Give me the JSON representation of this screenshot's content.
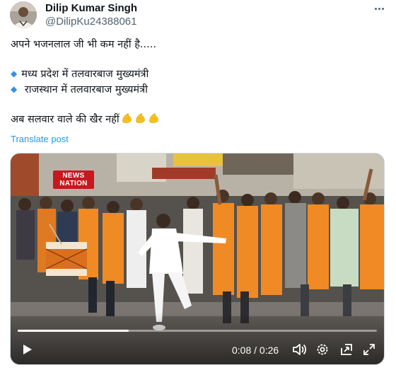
{
  "author": {
    "display_name": "Dilip Kumar Singh",
    "handle": "@DilipKu24388061"
  },
  "tweet": {
    "line1": "अपने भजनलाल जी भी कम नहीं है.....",
    "bullet1": "मध्य प्रदेश में तलवारबाज  मुख्यमंत्री",
    "bullet2": " राजस्थान में तलवारबाज मुख्यमंत्री",
    "line4": "अब सलवार वाले की खैर नहीं",
    "emoji_name": "flexed-biceps",
    "emoji_count": 3,
    "bullet_color": "#3d8ee0"
  },
  "translate_label": "Translate post",
  "video": {
    "channel_logo": "NEWS NATION",
    "logo_line1": "NEWS",
    "logo_line2": "NATION",
    "current_time": "0:08",
    "duration": "0:26",
    "time_display": "0:08 / 0:26",
    "progress_fraction": 0.31
  },
  "controls": {
    "play_icon": "play-icon",
    "volume_icon": "volume-icon",
    "settings_icon": "gear-icon",
    "minimize_icon": "picture-in-picture-icon",
    "fullscreen_icon": "fullscreen-icon"
  },
  "colors": {
    "link": "#1d9bf0",
    "text": "#0f1419",
    "secondary_text": "#536471",
    "saffron_shirts": "#f08a24"
  }
}
